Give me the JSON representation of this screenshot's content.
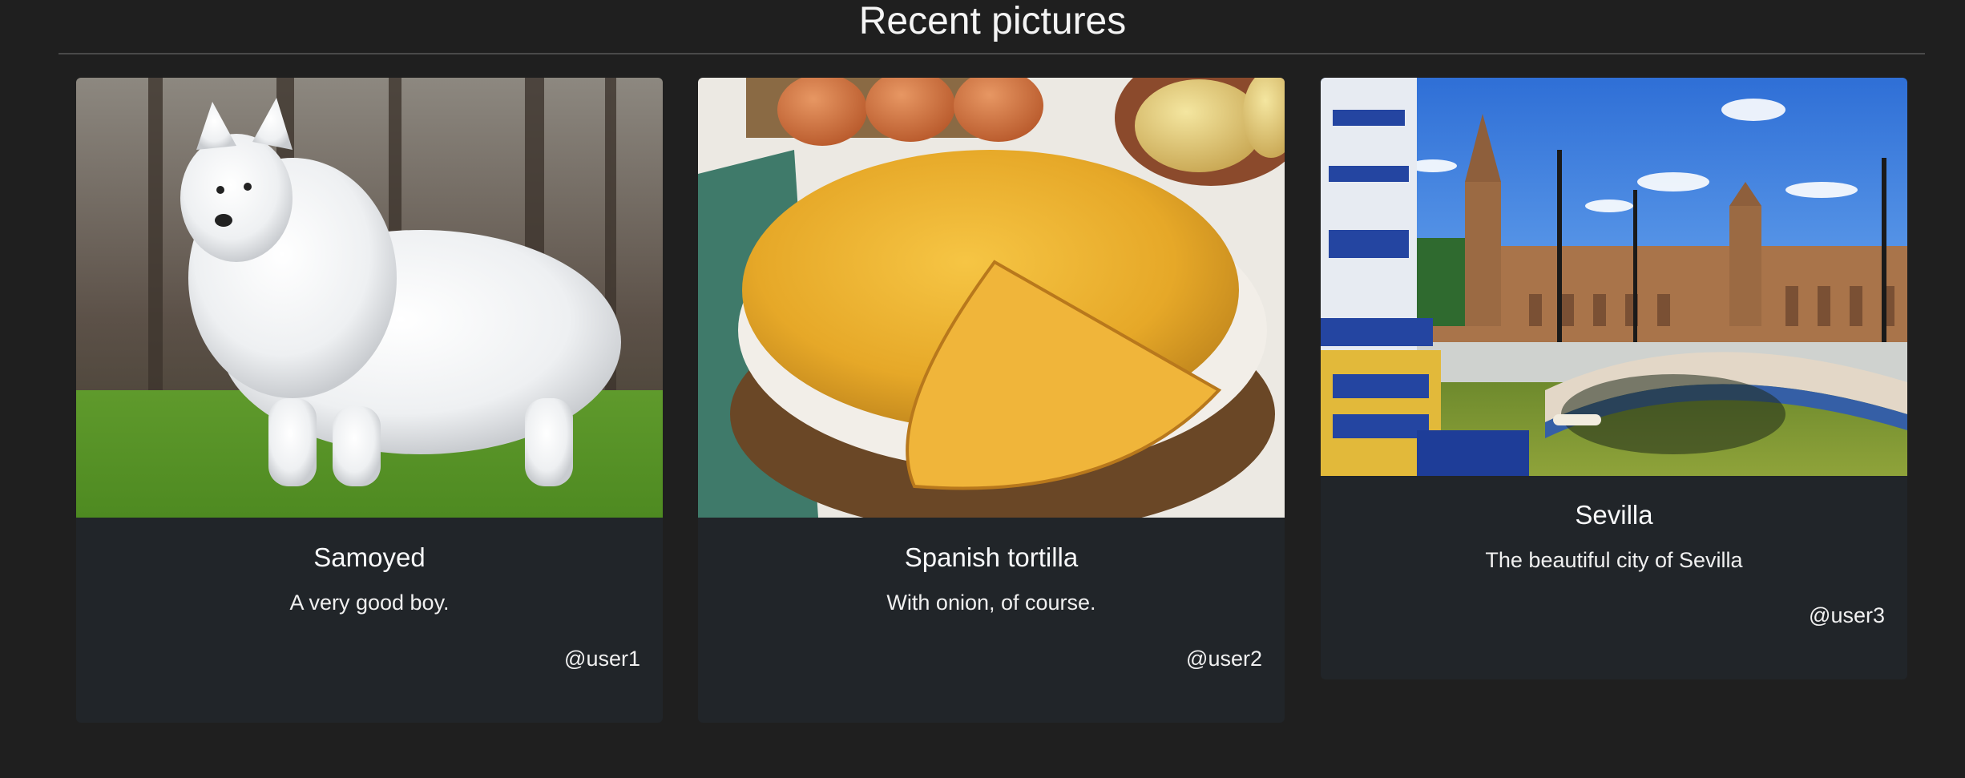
{
  "page": {
    "heading": "Recent pictures"
  },
  "pictures": [
    {
      "image_subject": "samoyed dog on grass",
      "title": "Samoyed",
      "description": "A very good boy.",
      "user": "@user1"
    },
    {
      "image_subject": "spanish tortilla on a plate",
      "title": "Spanish tortilla",
      "description": "With onion, of course.",
      "user": "@user2"
    },
    {
      "image_subject": "plaza de espana in sevilla",
      "title": "Sevilla",
      "description": "The beautiful city of Sevilla",
      "user": "@user3"
    }
  ],
  "colors": {
    "page_background": "#1f1f1f",
    "card_background": "#212529",
    "text": "#f8f9fa"
  }
}
